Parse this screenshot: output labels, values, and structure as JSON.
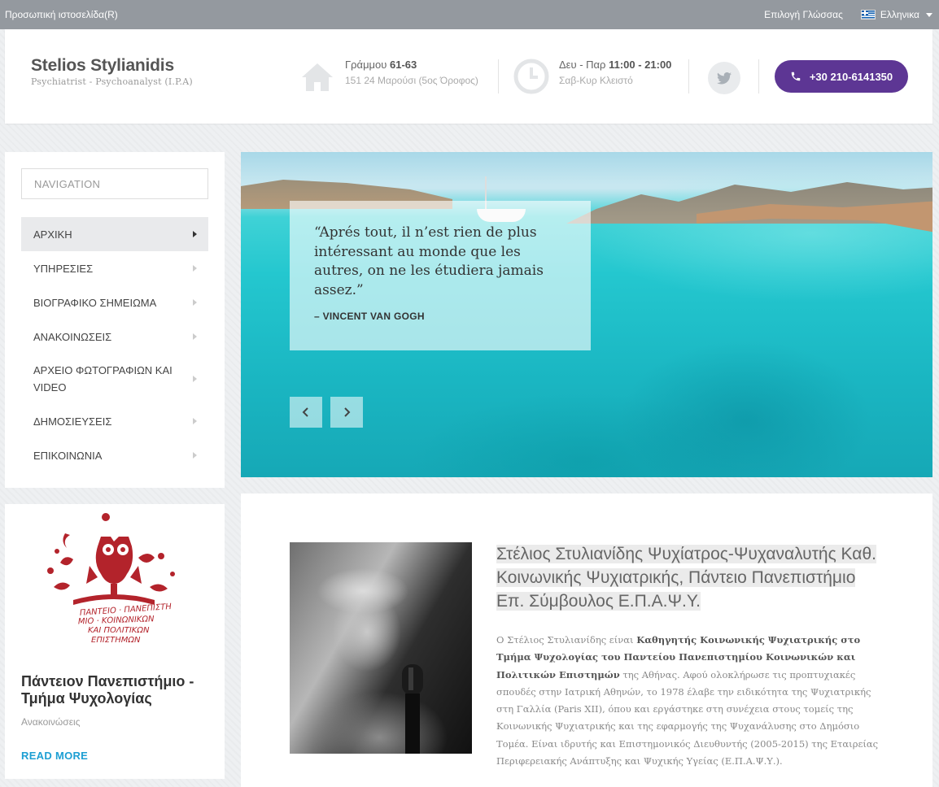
{
  "topbar": {
    "left_text": "Προσωπική ιστοσελίδα(R)",
    "lang_label": "Επιλογή Γλώσσας",
    "lang_current": "Ελληνικα"
  },
  "header": {
    "name": "Stelios Stylianidis",
    "subtitle": "Psychiatrist - Psychoanalyst (I.P.A)",
    "address_street": "Γράμμου",
    "address_number": "61-63",
    "address_city": "151 24 Μαρούσι (5ος Όροφος)",
    "hours_days": "Δευ - Παρ",
    "hours_time": "11:00 - 21:00",
    "hours_weekend": "Σαβ-Κυρ Κλειστό",
    "phone": "+30 210-6141350"
  },
  "nav": {
    "search_placeholder": "NAVIGATION",
    "items": [
      {
        "label": "ΑΡΧΙΚΗ"
      },
      {
        "label": "ΥΠΗΡΕΣΙΕΣ"
      },
      {
        "label": "ΒΙΟΓΡΑΦΙΚΟ ΣΗΜΕΙΩΜΑ"
      },
      {
        "label": "ΑΝΑΚΟΙΝΩΣΕΙΣ"
      },
      {
        "label": "ΑΡΧΕΙΟ ΦΩΤΟΓΡΑΦΙΩΝ ΚΑΙ VIDEO"
      },
      {
        "label": "ΔΗΜΟΣΙΕΥΣΕΙΣ"
      },
      {
        "label": "ΕΠΙΚΟΙΝΩΝΙΑ"
      }
    ]
  },
  "hero": {
    "quote": "“Aprés tout, il n’est rien de plus intéressant au monde que les autres, on ne les étudiera jamais assez.”",
    "author": "– VINCENT VAN GOGH"
  },
  "card": {
    "logo_text": "ΠΑΝΤΕΙΟ ΠΑΝΕΠΙΣΤΗΜΙΟ ΚΟΙΝΩΝΙΚΩΝ ΚΑΙ ΠΟΛΙΤΙΚΩΝ ΕΠΙΣΤΗΜΩΝ",
    "title": "Πάντειον Πανεπιστήμιο - Τμήμα Ψυχολογίας",
    "category": "Ανακοινώσεις",
    "read_more": "READ MORE"
  },
  "article": {
    "title": "Στέλιος Στυλιανίδης Ψυχίατρος-Ψυχαναλυτής Καθ. Κοινωνικής Ψυχιατρικής, Πάντειο Πανεπιστήμιο Επ. Σύμβουλος Ε.Π.Α.Ψ.Υ.",
    "body_intro": "Ο Στέλιος Στυλιανίδης είναι ",
    "body_bold": "Καθηγητής Κοινωνικής Ψυχιατρικής στο Τμήμα Ψυχολογίας του Παντείου Πανεπιστημίου Κοινωνικών και Πολιτικών Επιστημών",
    "body_rest": " της Αθήνας. Αφού ολοκλήρωσε τις προπτυχιακές σπουδές στην Ιατρική Αθηνών, το 1978 έλαβε την ειδικότητα της Ψυχιατρικής στη Γαλλία (Paris XII), όπου και εργάστηκε στη συνέχεια στους τομείς της Κοινωνικής Ψυχιατρικής και της εφαρμογής της Ψυχανάλυσης στο Δημόσιο Τομέα. Είναι ιδρυτής και Επιστημονικός Διευθυντής (2005-2015) της Εταιρείας Περιφερειακής Ανάπτυξης και Ψυχικής Υγείας (Ε.Π.Α.Ψ.Υ.)."
  },
  "colors": {
    "accent_purple": "#5d3694",
    "link_blue": "#1d9fd3",
    "logo_red": "#b3232b"
  }
}
